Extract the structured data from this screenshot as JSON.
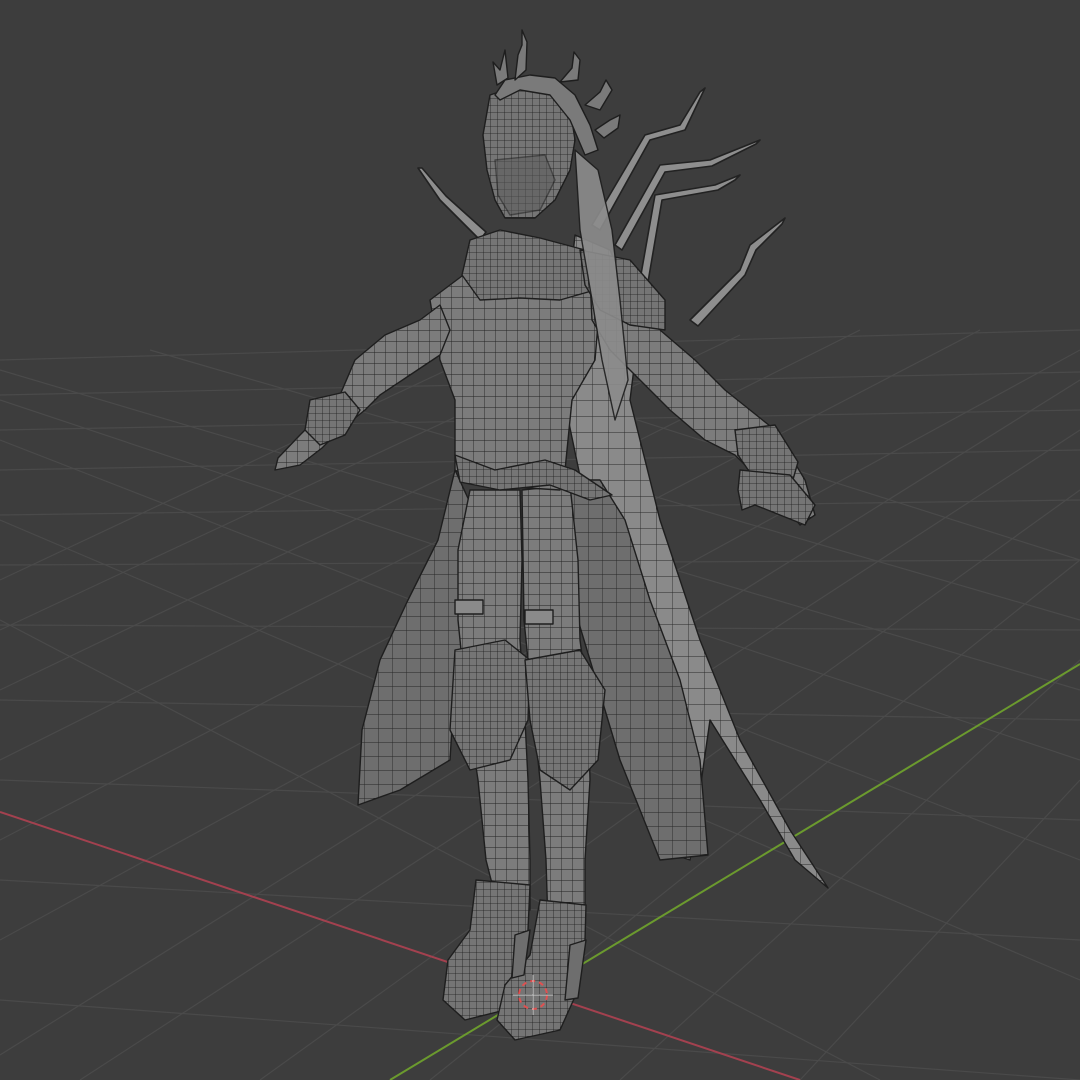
{
  "viewport": {
    "mode": "wireframe-overlay",
    "background_color": "#3d3d3d",
    "grid_color": "#4a4a4a",
    "x_axis_color": "#a3414f",
    "y_axis_color": "#6b9a2e",
    "mesh_fill_color": "#7a7a7a",
    "mesh_wire_color": "#1e1e1e",
    "origin_marker_color": "#e05050"
  },
  "scene_object": {
    "name_icon": "character-mesh-icon",
    "pose": "A-pose"
  },
  "icons": {
    "cursor": "3d-cursor-icon"
  }
}
